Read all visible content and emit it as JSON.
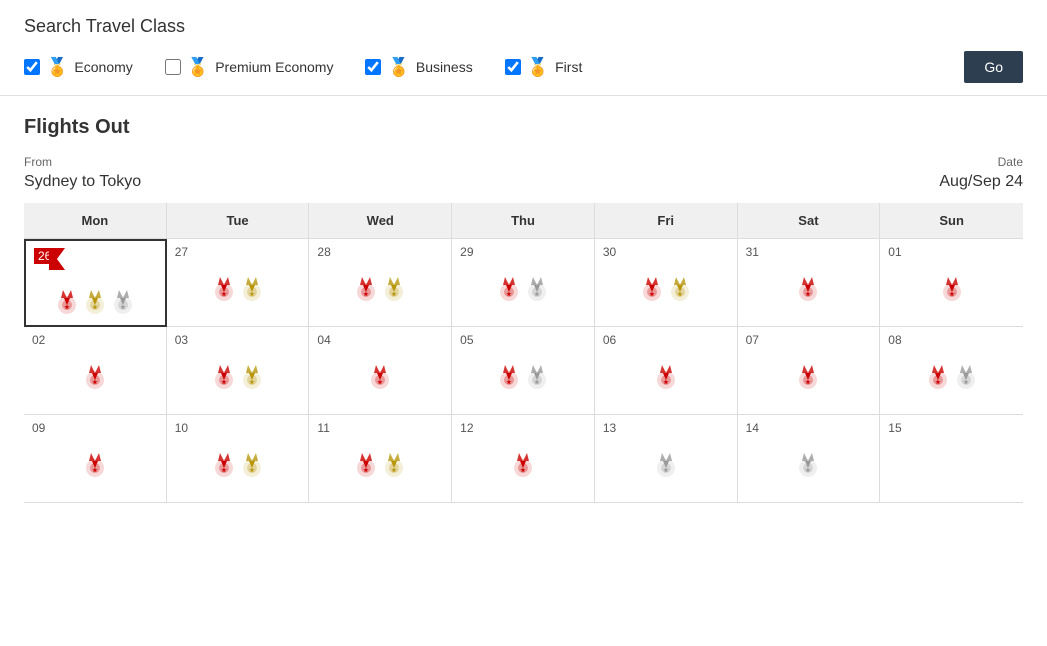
{
  "searchSection": {
    "title": "Search Travel Class",
    "classes": [
      {
        "id": "economy",
        "label": "Economy",
        "checked": true,
        "iconColor": "red"
      },
      {
        "id": "premium_economy",
        "label": "Premium Economy",
        "checked": false,
        "iconColor": "gold"
      },
      {
        "id": "business",
        "label": "Business",
        "checked": true,
        "iconColor": "red"
      },
      {
        "id": "first",
        "label": "First",
        "checked": true,
        "iconColor": "gold"
      }
    ],
    "goButton": "Go"
  },
  "flightsSection": {
    "title": "Flights Out",
    "fromLabel": "From",
    "fromValue": "Sydney to Tokyo",
    "dateLabel": "Date",
    "dateValue": "Aug/Sep 24"
  },
  "calendar": {
    "headers": [
      "Mon",
      "Tue",
      "Wed",
      "Thu",
      "Fri",
      "Sat",
      "Sun"
    ],
    "rows": [
      [
        {
          "date": "26",
          "today": true,
          "icons": [
            "red",
            "gold",
            "silver"
          ]
        },
        {
          "date": "27",
          "today": false,
          "icons": [
            "red",
            "gold"
          ]
        },
        {
          "date": "28",
          "today": false,
          "icons": [
            "red",
            "gold"
          ]
        },
        {
          "date": "29",
          "today": false,
          "icons": [
            "red",
            "silver"
          ]
        },
        {
          "date": "30",
          "today": false,
          "icons": [
            "red",
            "gold"
          ]
        },
        {
          "date": "31",
          "today": false,
          "icons": [
            "red"
          ]
        },
        {
          "date": "01",
          "today": false,
          "icons": [
            "red"
          ]
        }
      ],
      [
        {
          "date": "02",
          "today": false,
          "icons": [
            "red"
          ]
        },
        {
          "date": "03",
          "today": false,
          "icons": [
            "red",
            "gold"
          ]
        },
        {
          "date": "04",
          "today": false,
          "icons": [
            "red"
          ]
        },
        {
          "date": "05",
          "today": false,
          "icons": [
            "red",
            "silver"
          ]
        },
        {
          "date": "06",
          "today": false,
          "icons": [
            "red"
          ]
        },
        {
          "date": "07",
          "today": false,
          "icons": [
            "red"
          ]
        },
        {
          "date": "08",
          "today": false,
          "icons": [
            "red",
            "silver"
          ]
        }
      ],
      [
        {
          "date": "09",
          "today": false,
          "icons": [
            "red"
          ]
        },
        {
          "date": "10",
          "today": false,
          "icons": [
            "red",
            "gold"
          ]
        },
        {
          "date": "11",
          "today": false,
          "icons": [
            "red",
            "gold"
          ]
        },
        {
          "date": "12",
          "today": false,
          "icons": [
            "red"
          ]
        },
        {
          "date": "13",
          "today": false,
          "icons": [
            "silver"
          ]
        },
        {
          "date": "14",
          "today": false,
          "icons": [
            "silver"
          ]
        },
        {
          "date": "15",
          "today": false,
          "icons": []
        }
      ]
    ]
  }
}
